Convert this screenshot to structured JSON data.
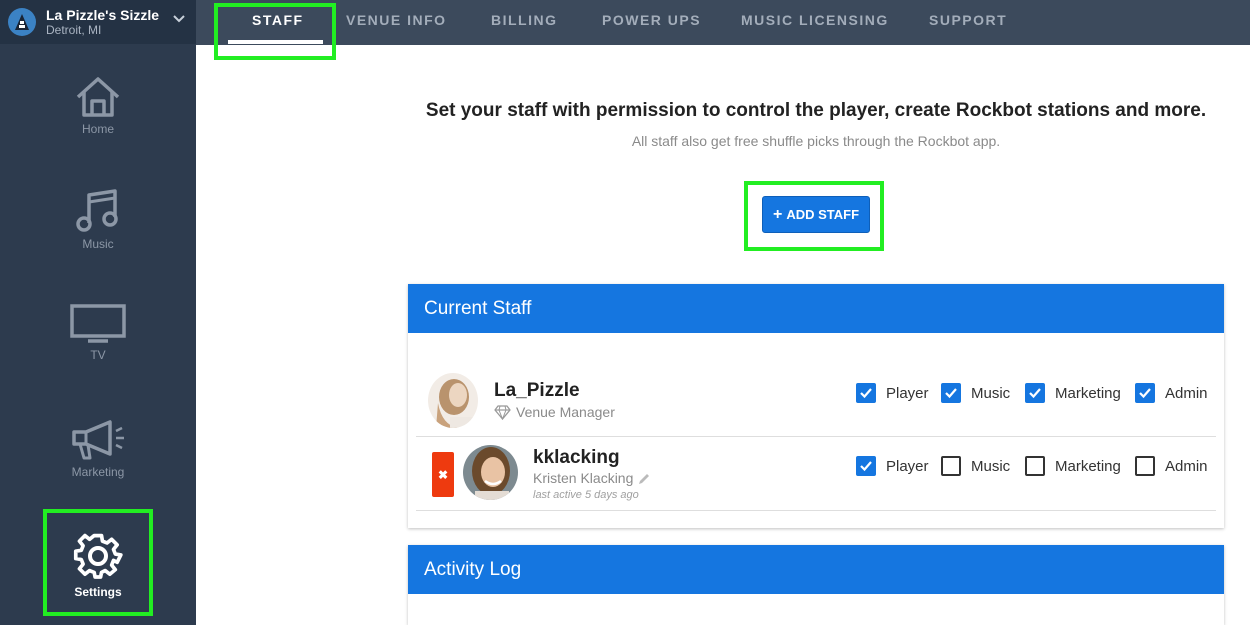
{
  "venue": {
    "name": "La Pizzle's Sizzle",
    "location": "Detroit, MI"
  },
  "sidebar": {
    "items": [
      {
        "label": "Home",
        "icon": "home-icon"
      },
      {
        "label": "Music",
        "icon": "music-note-icon"
      },
      {
        "label": "TV",
        "icon": "tv-icon"
      },
      {
        "label": "Marketing",
        "icon": "megaphone-icon"
      },
      {
        "label": "Settings",
        "icon": "gear-icon",
        "active": true
      }
    ]
  },
  "tabs": [
    {
      "label": "STAFF",
      "active": true
    },
    {
      "label": "VENUE INFO"
    },
    {
      "label": "BILLING"
    },
    {
      "label": "POWER UPS"
    },
    {
      "label": "MUSIC LICENSING"
    },
    {
      "label": "SUPPORT"
    }
  ],
  "main": {
    "headline": "Set your staff with permission to control the player, create Rockbot stations and more.",
    "subline": "All staff also get free shuffle picks through the Rockbot app.",
    "add_staff_label": "ADD STAFF"
  },
  "current_staff": {
    "title": "Current Staff",
    "members": [
      {
        "username": "La_Pizzle",
        "role": "Venue Manager",
        "permissions": {
          "Player": true,
          "Music": true,
          "Marketing": true,
          "Admin": true
        }
      },
      {
        "username": "kklacking",
        "full_name": "Kristen Klacking",
        "last_active": "last active 5 days ago",
        "permissions": {
          "Player": true,
          "Music": false,
          "Marketing": false,
          "Admin": false
        }
      }
    ]
  },
  "permission_labels": [
    "Player",
    "Music",
    "Marketing",
    "Admin"
  ],
  "activity_log": {
    "title": "Activity Log"
  },
  "colors": {
    "accent": "#1576e0",
    "sidebar": "#2d3b4e",
    "topbar": "#3c4a5c",
    "highlight": "#22ee22",
    "remove": "#ee3a0f"
  }
}
